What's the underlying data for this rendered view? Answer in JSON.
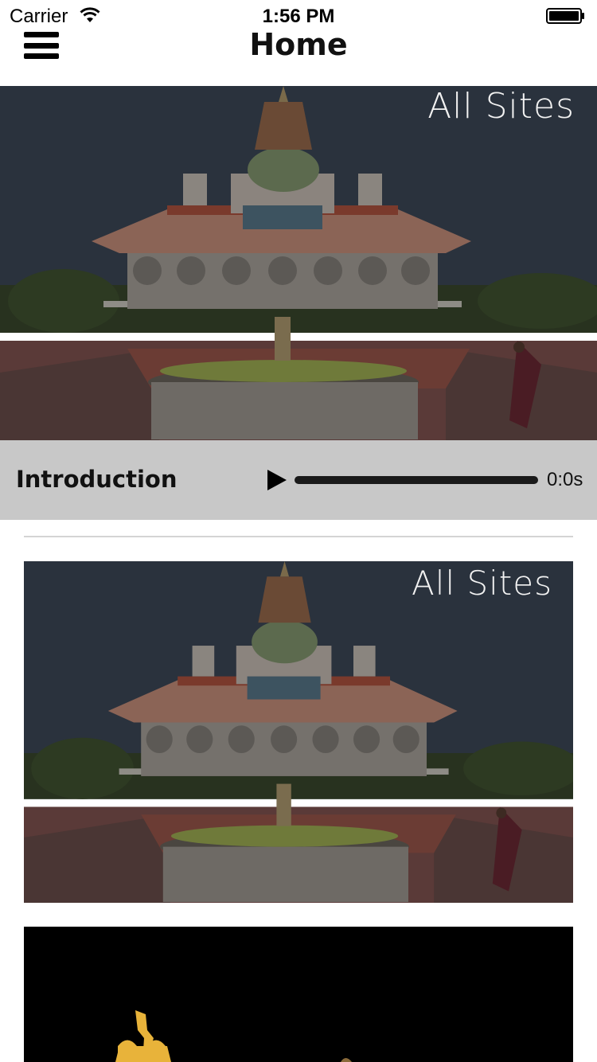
{
  "status_bar": {
    "carrier": "Carrier",
    "time": "1:56 PM"
  },
  "nav": {
    "title": "Home",
    "menu_icon": "hamburger-menu-icon"
  },
  "hero": {
    "overlay_text": "All Sites"
  },
  "audio": {
    "title": "Introduction",
    "time": "0:0s",
    "progress": 0,
    "play_icon": "play-icon"
  },
  "cards": [
    {
      "overlay_text": "All Sites"
    },
    {
      "overlay_text": ""
    }
  ],
  "colors": {
    "audio_bar_bg": "#c8c8c8",
    "background": "#ffffff",
    "text": "#111111"
  }
}
